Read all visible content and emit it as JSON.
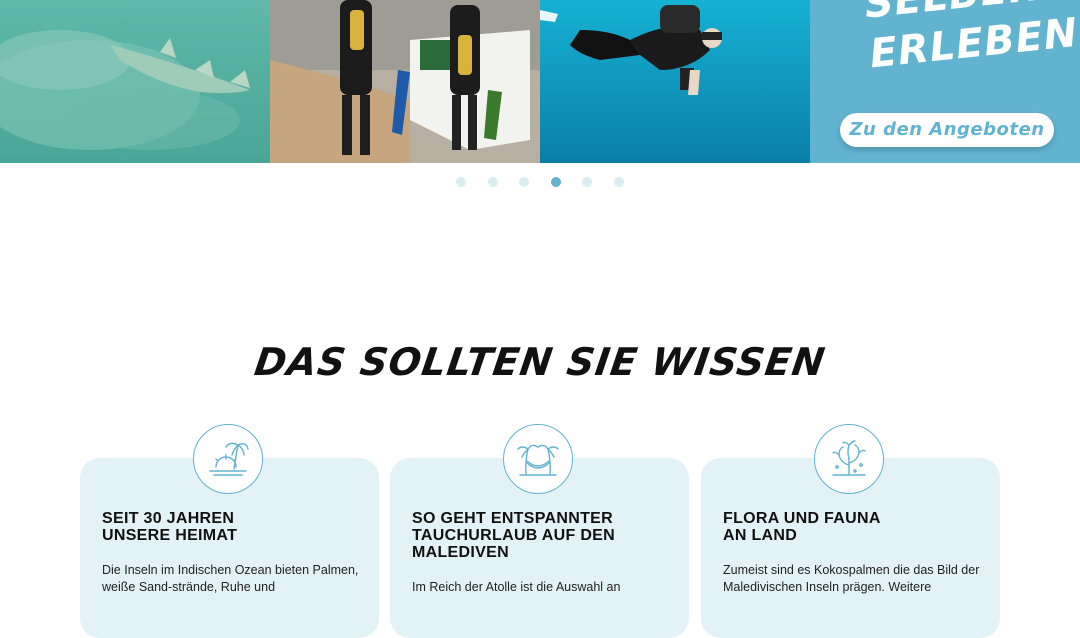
{
  "hero": {
    "tiles": [
      {
        "name": "shark-on-sand-photo"
      },
      {
        "name": "divers-on-beach-photo"
      },
      {
        "name": "underwater-diver-photo"
      }
    ],
    "promo": {
      "title_line1": "Selber",
      "title_line2": "Erleben",
      "button_label": "Zu den Angeboten",
      "color": "#62b3d0"
    }
  },
  "carousel": {
    "dot_count": 6,
    "active_index": 3
  },
  "section": {
    "title": "Das sollten Sie wissen"
  },
  "cards": [
    {
      "icon": "island-sunset-icon",
      "title": "Seit 30 Jahren\nunsere Heimat",
      "text": "Die Inseln im Indischen Ozean bieten Palmen, weiße Sand-strände, Ruhe und"
    },
    {
      "icon": "palm-hammock-icon",
      "title": "So geht entspannter\nTauchurlaub auf den\nMalediven",
      "text": "Im Reich der Atolle ist die Auswahl an"
    },
    {
      "icon": "coral-icon",
      "title": "Flora und Fauna\nan Land",
      "text": "Zumeist sind es Kokospalmen die das Bild der Maledivischen Inseln prägen. Weitere"
    }
  ]
}
